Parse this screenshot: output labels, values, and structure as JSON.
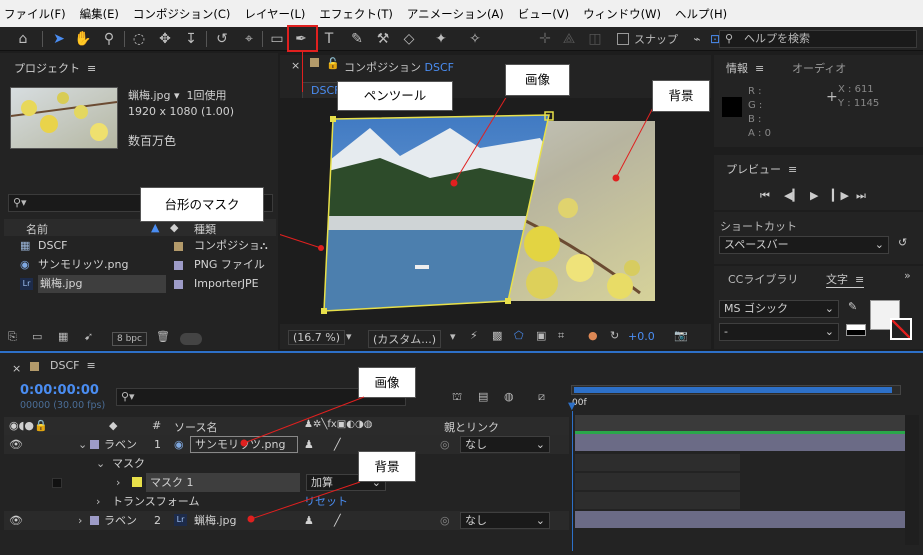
{
  "menu": [
    "ファイル(F)",
    "編集(E)",
    "コンポジション(C)",
    "レイヤー(L)",
    "エフェクト(T)",
    "アニメーション(A)",
    "ビュー(V)",
    "ウィンドウ(W)",
    "ヘルプ(H)"
  ],
  "toolbar": {
    "snap": "スナップ",
    "help_placeholder": "ヘルプを検索"
  },
  "project": {
    "title": "プロジェクト",
    "selected_name": "蝋梅.jpg ▾",
    "usage": "1回使用",
    "dims": "1920 x 1080 (1.00)",
    "color": "数百万色",
    "col_name": "名前",
    "col_type": "種類",
    "items": [
      {
        "name": "DSCF",
        "type": "コンポジショ"
      },
      {
        "name": "サンモリッツ.png",
        "type": "PNG ファイル"
      },
      {
        "name": "蝋梅.jpg",
        "type": "ImporterJPE"
      }
    ],
    "bpc": "8 bpc"
  },
  "viewer": {
    "tab_prefix": "コンポジション",
    "tab_name": "DSCF",
    "crumb": "DSCF",
    "zoom": "(16.7 %)",
    "resolution": "(カスタム...)",
    "exposure": "+0.0"
  },
  "annotations": {
    "pen_tool": "ペンツール",
    "image_top": "画像",
    "background_top": "背景",
    "mask": "台形のマスク",
    "image_tl": "画像",
    "background_tl": "背景"
  },
  "info": {
    "tab1": "情報",
    "tab2": "オーディオ",
    "r": "R :",
    "g": "G :",
    "b": "B :",
    "a": "A : 0",
    "x": "X : 611",
    "y": "Y : 1145"
  },
  "preview": {
    "title": "プレビュー"
  },
  "shortcut": {
    "label": "ショートカット",
    "value": "スペースバー"
  },
  "text_panel": {
    "tab1": "CCライブラリ",
    "tab2": "文字",
    "font": "MS ゴシック",
    "style": "-"
  },
  "timeline": {
    "comp": "DSCF",
    "time": "0:00:00:00",
    "frames": "00000 (30.00 fps)",
    "col_source": "ソース名",
    "col_parent": "親とリンク",
    "ruler_label": "00f",
    "layers": [
      {
        "label": "ラベン",
        "num": "1",
        "name": "サンモリッツ.png",
        "parent": "なし"
      },
      {
        "label": "ラベン",
        "num": "2",
        "name": "蝋梅.jpg",
        "parent": "なし"
      }
    ],
    "mask_group": "マスク",
    "mask1": "マスク 1",
    "mask_mode": "加算",
    "transform": "トランスフォーム",
    "reset": "リセット"
  },
  "colors": {
    "accent": "#2d70c8",
    "annotation_red": "#e0201f",
    "mask_yellow": "#e8e04a"
  }
}
